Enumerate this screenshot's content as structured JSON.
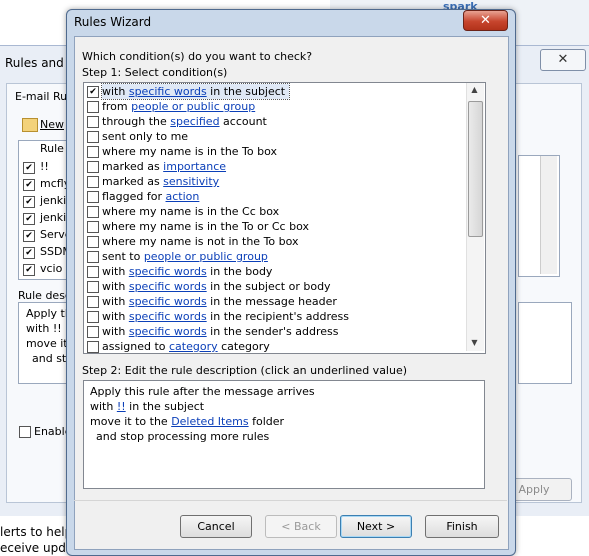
{
  "background_window": {
    "title": "Rules and A",
    "close_glyph": "✕",
    "tab_label": "E-mail Rule",
    "new_label": "New",
    "column_header": "Rule",
    "rules": [
      {
        "name": "!!",
        "checked": true
      },
      {
        "name": "mcfly",
        "checked": true
      },
      {
        "name": "jenki",
        "checked": true
      },
      {
        "name": "jenki",
        "checked": true
      },
      {
        "name": "Serve",
        "checked": true
      },
      {
        "name": "SSDM",
        "checked": true
      },
      {
        "name": "vcio",
        "checked": true
      }
    ],
    "rule_desc_label": "Rule desc",
    "desc_lines": [
      "Apply the",
      "with !! in",
      "move it",
      "and sto"
    ],
    "enable_label": "Enable",
    "apply_label": "Apply",
    "spark_text": "spark",
    "bottom_lines": [
      "lerts to help",
      "eceive upd"
    ]
  },
  "dialog": {
    "title": "Rules Wizard",
    "close_glyph": "✕",
    "question": "Which condition(s) do you want to check?",
    "step1_label": "Step 1: Select condition(s)",
    "conditions": [
      {
        "checked": true,
        "pre": "with ",
        "link": "specific words",
        "post": " in the subject"
      },
      {
        "checked": false,
        "pre": "from ",
        "link": "people or public group",
        "post": ""
      },
      {
        "checked": false,
        "pre": "through the ",
        "link": "specified",
        "post": " account"
      },
      {
        "checked": false,
        "pre": "sent only to me",
        "link": "",
        "post": ""
      },
      {
        "checked": false,
        "pre": "where my name is in the To box",
        "link": "",
        "post": ""
      },
      {
        "checked": false,
        "pre": "marked as ",
        "link": "importance",
        "post": ""
      },
      {
        "checked": false,
        "pre": "marked as ",
        "link": "sensitivity",
        "post": ""
      },
      {
        "checked": false,
        "pre": "flagged for ",
        "link": "action",
        "post": ""
      },
      {
        "checked": false,
        "pre": "where my name is in the Cc box",
        "link": "",
        "post": ""
      },
      {
        "checked": false,
        "pre": "where my name is in the To or Cc box",
        "link": "",
        "post": ""
      },
      {
        "checked": false,
        "pre": "where my name is not in the To box",
        "link": "",
        "post": ""
      },
      {
        "checked": false,
        "pre": "sent to ",
        "link": "people or public group",
        "post": ""
      },
      {
        "checked": false,
        "pre": "with ",
        "link": "specific words",
        "post": " in the body"
      },
      {
        "checked": false,
        "pre": "with ",
        "link": "specific words",
        "post": " in the subject or body"
      },
      {
        "checked": false,
        "pre": "with ",
        "link": "specific words",
        "post": " in the message header"
      },
      {
        "checked": false,
        "pre": "with ",
        "link": "specific words",
        "post": " in the recipient's address"
      },
      {
        "checked": false,
        "pre": "with ",
        "link": "specific words",
        "post": " in the sender's address"
      },
      {
        "checked": false,
        "pre": "assigned to ",
        "link": "category",
        "post": " category"
      }
    ],
    "step2_label": "Step 2: Edit the rule description (click an underlined value)",
    "description": {
      "line1": "Apply this rule after the message arrives",
      "line2_pre": "with ",
      "line2_link": "!!",
      "line2_post": " in the subject",
      "line3_pre": "move it to the ",
      "line3_link": "Deleted Items",
      "line3_post": " folder",
      "line4": "and stop processing more rules"
    },
    "buttons": {
      "cancel": "Cancel",
      "back": "< Back",
      "next": "Next >",
      "finish": "Finish"
    }
  },
  "colors": {
    "link": "#0b3fb8",
    "dialog_frame": "#c9d8ea",
    "close_button": "#c7452d"
  }
}
